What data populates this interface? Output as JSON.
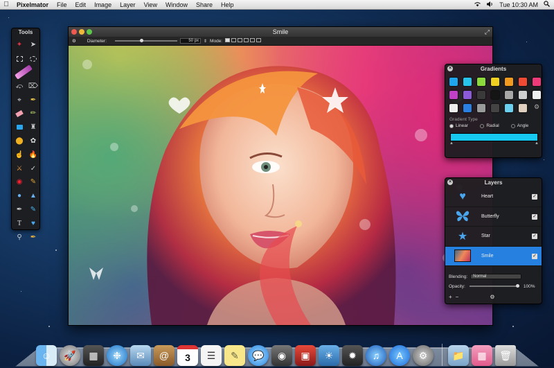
{
  "menubar": {
    "apple_icon": "apple-logo-icon",
    "items": [
      "Pixelmator",
      "File",
      "Edit",
      "Image",
      "Layer",
      "View",
      "Window",
      "Share",
      "Help"
    ],
    "clock": "Tue 10:30 AM",
    "status_icons": [
      "wifi-icon",
      "volume-icon",
      "search-icon"
    ]
  },
  "tools_panel": {
    "title": "Tools",
    "tools": [
      "magic-wand",
      "move",
      "rect-select",
      "ellipse-select",
      "eraser-pen",
      "lasso",
      "magnetic-lasso",
      "eyedropper",
      "crop",
      "brush",
      "eraser",
      "pencil",
      "fill-bucket",
      "clone-stamp",
      "paint-bucket",
      "sponge",
      "smudge",
      "burn",
      "dodge",
      "heal",
      "red-eye",
      "sharpen",
      "blur",
      "gradient-drop",
      "pen",
      "line",
      "type",
      "shape",
      "zoom",
      "color-picker"
    ]
  },
  "document": {
    "title": "Smile",
    "options": {
      "diameter_label": "Diameter:",
      "diameter_value": "50 px",
      "mode_label": "Mode:"
    }
  },
  "gradients_panel": {
    "title": "Gradients",
    "swatch_colors": [
      "#1ea6ef",
      "#27c3ea",
      "#8bd93a",
      "#f0d020",
      "#f09a20",
      "#ef4a33",
      "#ef3a7a",
      "#c040c8",
      "#8a5ad8",
      "#3a3a3a",
      "#151515",
      "#a8a8a8",
      "#cfcfcf",
      "#f0f0f0",
      "#eeeeee",
      "#2a7fe0",
      "#9a9a9a",
      "#444444",
      "#6bd0f0",
      "#e0d0c0"
    ],
    "gradient_type_label": "Gradient Type",
    "types": [
      "Linear",
      "Radial",
      "Angle"
    ],
    "selected_type": "Linear",
    "bar_color": "#17c8f0"
  },
  "layers_panel": {
    "title": "Layers",
    "layers": [
      {
        "name": "Heart",
        "icon": "heart-icon",
        "visible": true
      },
      {
        "name": "Butterfly",
        "icon": "butterfly-icon",
        "visible": true
      },
      {
        "name": "Star",
        "icon": "star-icon",
        "visible": true
      },
      {
        "name": "Smile",
        "icon": "photo-thumbnail",
        "visible": true,
        "selected": true
      }
    ],
    "blending_label": "Blending:",
    "blending_value": "Normal",
    "opacity_label": "Opacity:",
    "opacity_value": "100%",
    "footer": [
      "+",
      "−",
      "⚙"
    ]
  },
  "dock": {
    "apps": [
      "Finder",
      "Launchpad",
      "Mission Control",
      "Safari",
      "Mail",
      "Contacts",
      "Calendar",
      "Reminders",
      "Notes",
      "Messages",
      "FaceTime",
      "Photo Booth",
      "iPhoto",
      "Aperture",
      "iTunes",
      "App Store",
      "System Preferences",
      "Applications",
      "Pictures",
      "Trash"
    ],
    "calendar_day": "3"
  }
}
